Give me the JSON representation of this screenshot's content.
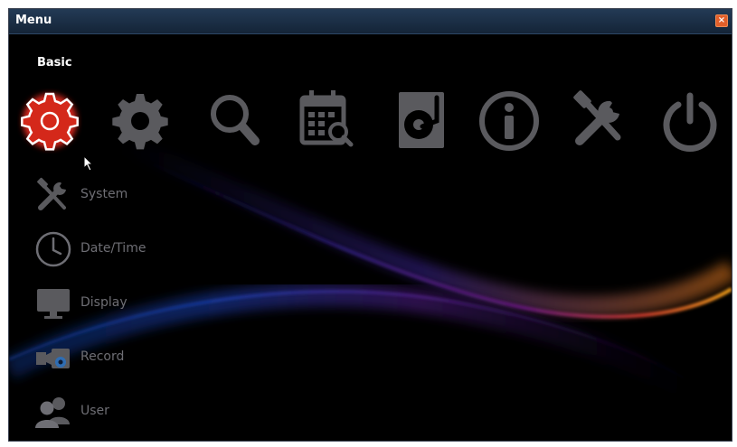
{
  "window": {
    "title": "Menu",
    "close_glyph": "×"
  },
  "section": {
    "label": "Basic"
  },
  "top_icons": [
    {
      "icon": "gear-icon",
      "selected": true
    },
    {
      "icon": "gear-icon",
      "selected": false
    },
    {
      "icon": "search-icon",
      "selected": false
    },
    {
      "icon": "calendar-search-icon",
      "selected": false
    },
    {
      "icon": "hard-disk-icon",
      "selected": false
    },
    {
      "icon": "info-icon",
      "selected": false
    },
    {
      "icon": "tools-icon",
      "selected": false
    },
    {
      "icon": "power-icon",
      "selected": false
    }
  ],
  "side_menu": {
    "items": [
      {
        "label": "System",
        "icon": "tools-icon"
      },
      {
        "label": "Date/Time",
        "icon": "clock-icon"
      },
      {
        "label": "Display",
        "icon": "monitor-icon"
      },
      {
        "label": "Record",
        "icon": "camera-record-icon"
      },
      {
        "label": "User",
        "icon": "users-icon"
      }
    ]
  },
  "colors": {
    "selected_icon": "#ffffff",
    "selected_glow": "#d4281a",
    "inactive_icon": "#5a5a5e",
    "title_bar": "#1a2e46",
    "close_button": "#e25f2a"
  }
}
